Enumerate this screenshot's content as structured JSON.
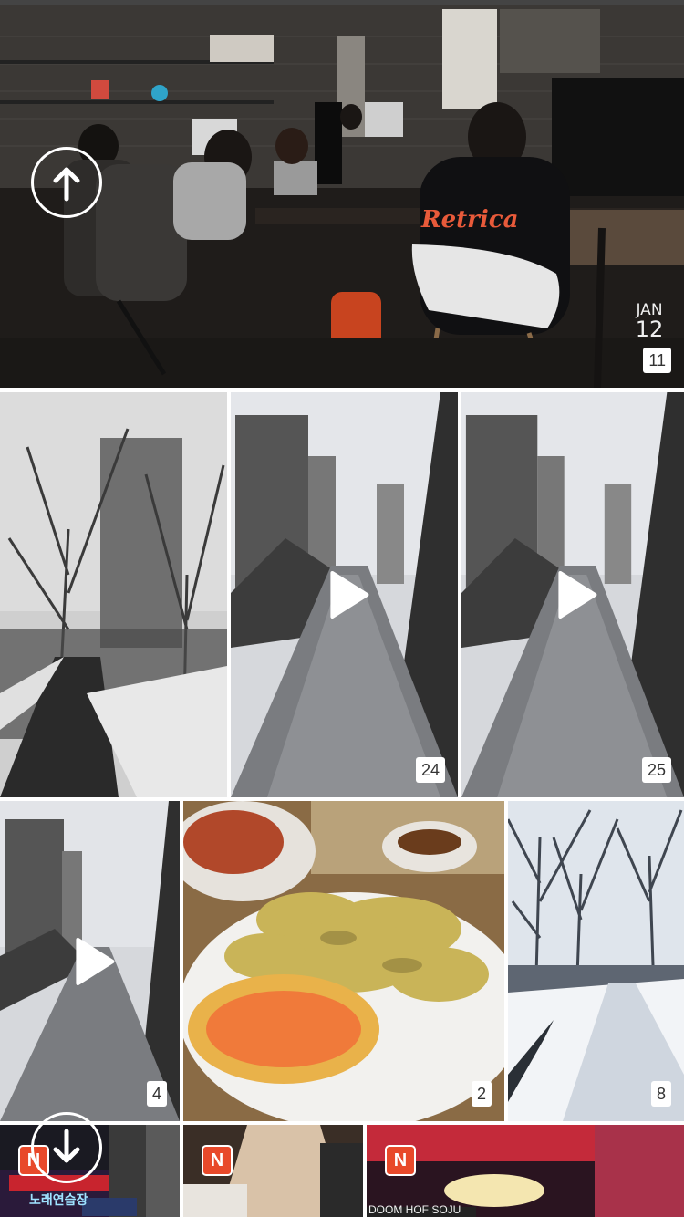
{
  "gallery": {
    "top_photo": {
      "stamp_month": "JAN",
      "stamp_day": "12",
      "count": "11",
      "hoodie_text": "Retrica"
    },
    "row2": [
      {
        "kind": "photo",
        "count": ""
      },
      {
        "kind": "video",
        "count": "24"
      },
      {
        "kind": "video",
        "count": "25"
      }
    ],
    "row3": [
      {
        "kind": "video",
        "count": "4"
      },
      {
        "kind": "photo",
        "count": "2"
      },
      {
        "kind": "photo",
        "count": "8"
      }
    ],
    "row4": [
      {
        "badge": "N",
        "sign_text": "노래연습장"
      },
      {
        "badge": "N"
      },
      {
        "badge": "N",
        "sign_text": "DOOM HOF SOJU"
      }
    ]
  },
  "icons": {
    "scroll_up": "arrow-up-circle-icon",
    "scroll_down": "arrow-down-circle-icon",
    "play": "play-icon"
  },
  "colors": {
    "badge": "#e8492a",
    "background": "#ffffff"
  }
}
